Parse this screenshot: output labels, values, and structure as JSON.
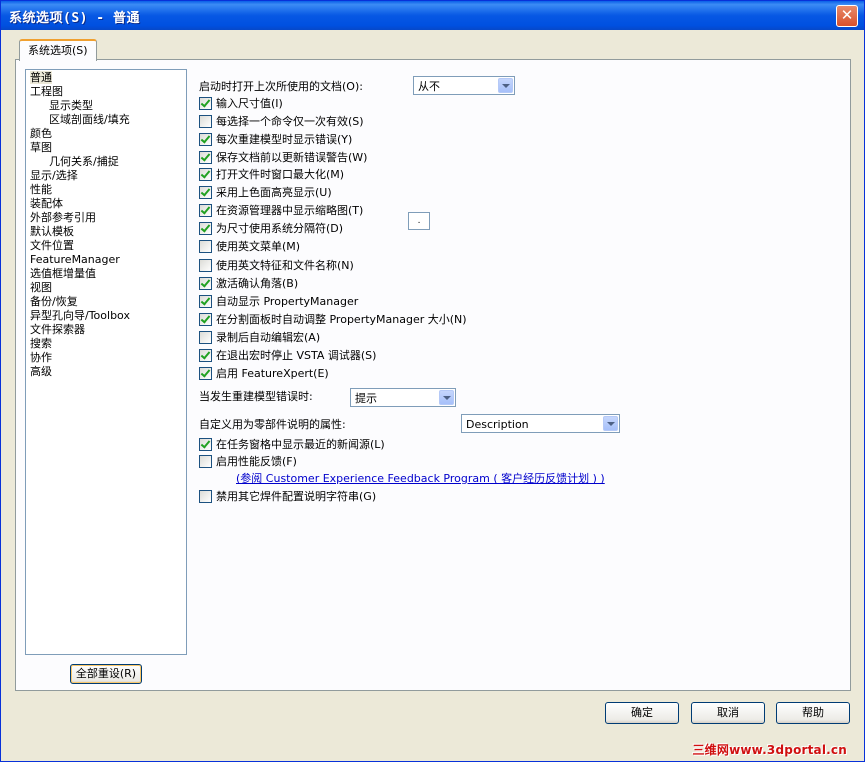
{
  "window": {
    "title": "系统选项(S) - 普通"
  },
  "tab": {
    "label": "系统选项(S)"
  },
  "tree": [
    {
      "label": "普通",
      "level": 0,
      "selected": true
    },
    {
      "label": "工程图",
      "level": 0
    },
    {
      "label": "显示类型",
      "level": 1
    },
    {
      "label": "区域剖面线/填充",
      "level": 1
    },
    {
      "label": "颜色",
      "level": 0
    },
    {
      "label": "草图",
      "level": 0
    },
    {
      "label": "几何关系/捕捉",
      "level": 1
    },
    {
      "label": "显示/选择",
      "level": 0
    },
    {
      "label": "性能",
      "level": 0
    },
    {
      "label": "装配体",
      "level": 0
    },
    {
      "label": "外部参考引用",
      "level": 0
    },
    {
      "label": "默认模板",
      "level": 0
    },
    {
      "label": "文件位置",
      "level": 0
    },
    {
      "label": "FeatureManager",
      "level": 0
    },
    {
      "label": "选值框增量值",
      "level": 0
    },
    {
      "label": "视图",
      "level": 0
    },
    {
      "label": "备份/恢复",
      "level": 0
    },
    {
      "label": "异型孔向导/Toolbox",
      "level": 0
    },
    {
      "label": "文件探索器",
      "level": 0
    },
    {
      "label": "搜索",
      "level": 0
    },
    {
      "label": "协作",
      "level": 0
    },
    {
      "label": "高级",
      "level": 0
    }
  ],
  "reset_button": "全部重设(R)",
  "open_docs": {
    "label": "启动时打开上次所使用的文档(O):",
    "value": "从不"
  },
  "checkboxes": [
    {
      "label": "输入尺寸值(I)",
      "checked": true
    },
    {
      "label": "每选择一个命令仅一次有效(S)",
      "checked": false
    },
    {
      "label": "每次重建模型时显示错误(Y)",
      "checked": true
    },
    {
      "label": "保存文档前以更新错误警告(W)",
      "checked": true
    },
    {
      "label": "打开文件时窗口最大化(M)",
      "checked": true
    },
    {
      "label": "采用上色面高亮显示(U)",
      "checked": true
    },
    {
      "label": "在资源管理器中显示缩略图(T)",
      "checked": true
    },
    {
      "label": "为尺寸使用系统分隔符(D)",
      "checked": true
    },
    {
      "label": "使用英文菜单(M)",
      "checked": false
    },
    {
      "label": "使用英文特征和文件名称(N)",
      "checked": false
    },
    {
      "label": "激活确认角落(B)",
      "checked": true
    },
    {
      "label": "自动显示 PropertyManager",
      "checked": true
    },
    {
      "label": "在分割面板时自动调整 PropertyManager 大小(N)",
      "checked": true
    },
    {
      "label": "录制后自动编辑宏(A)",
      "checked": false
    },
    {
      "label": "在退出宏时停止 VSTA 调试器(S)",
      "checked": true
    },
    {
      "label": "启用 FeatureXpert(E)",
      "checked": true
    }
  ],
  "separator_value": ".",
  "rebuild_error": {
    "label": "当发生重建模型错误时:",
    "value": "提示"
  },
  "custom_prop": {
    "label": "自定义用为零部件说明的属性:",
    "value": "Description"
  },
  "checkboxes2": [
    {
      "label": "在任务窗格中显示最近的新闻源(L)",
      "checked": true
    },
    {
      "label": "启用性能反馈(F)",
      "checked": false
    }
  ],
  "feedback_link": "(参阅 Customer Experience Feedback Program ( 客户经历反馈计划 ) )",
  "checkboxes3": [
    {
      "label": "禁用其它焊件配置说明字符串(G)",
      "checked": false
    }
  ],
  "buttons": {
    "ok": "确定",
    "cancel": "取消",
    "help": "帮助"
  },
  "watermark": "三维网www.3dportal.cn"
}
